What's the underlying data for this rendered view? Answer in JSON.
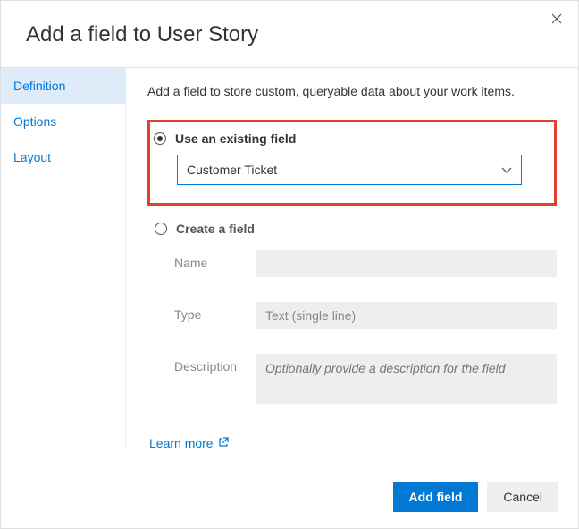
{
  "title": "Add a field to User Story",
  "tabs": {
    "definition": "Definition",
    "options": "Options",
    "layout": "Layout"
  },
  "main": {
    "description": "Add a field to store custom, queryable data about your work items.",
    "existing": {
      "label": "Use an existing field",
      "selected": "Customer Ticket"
    },
    "create": {
      "label": "Create a field",
      "name_label": "Name",
      "type_label": "Type",
      "type_value": "Text (single line)",
      "desc_label": "Description",
      "desc_placeholder": "Optionally provide a description for the field"
    },
    "learn_more": "Learn more"
  },
  "footer": {
    "add": "Add field",
    "cancel": "Cancel"
  }
}
